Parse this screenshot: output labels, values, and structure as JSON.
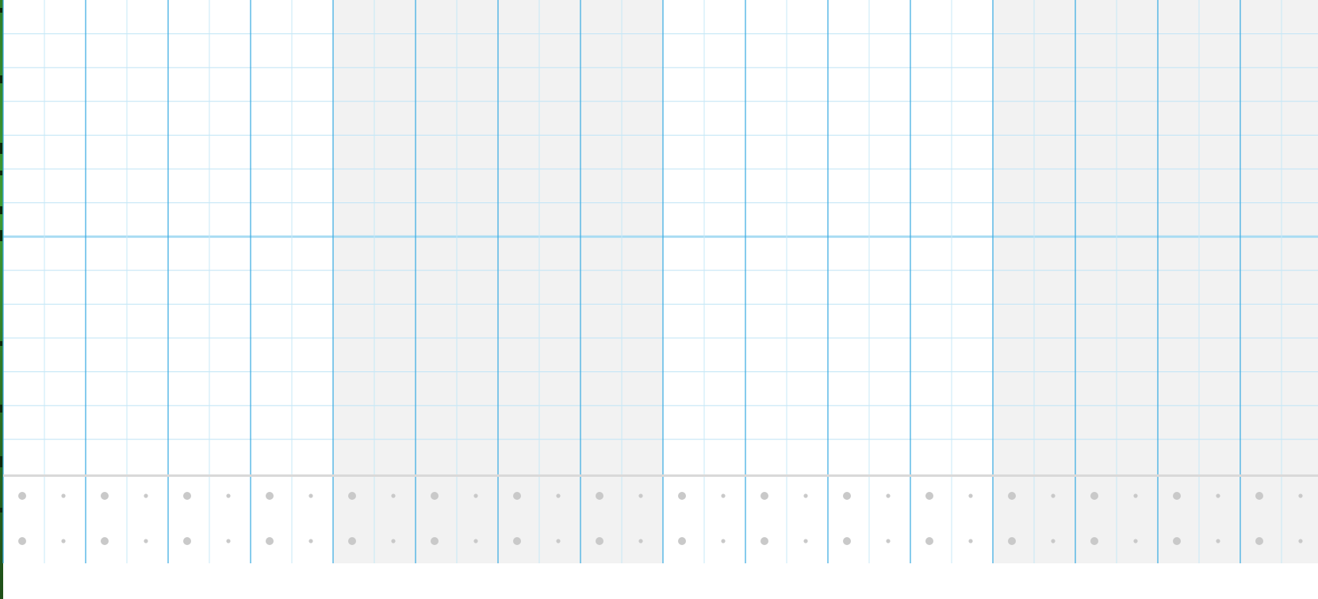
{
  "colors": {
    "page": "#ffffff",
    "bar_band": "#f2f2f2",
    "beat_line": "#36a9e1",
    "sub_line": "#c7e8f7",
    "row_line": "#bfe4f6",
    "octave_line": "#a9dcf3",
    "velocity_separator": "#d9d9d9",
    "velocity_dot": "#c9c9c9",
    "left_edge": "#2f7d28"
  },
  "grid": {
    "bars": 4,
    "beats_per_bar": 4,
    "subdivisions_per_beat": 2,
    "note_rows": 14,
    "highlighted_row_index": 7,
    "shaded_bars": [
      1,
      3
    ],
    "velocity_lanes": 2
  },
  "icons": {
    "velocity_marker": "circle-dot"
  }
}
